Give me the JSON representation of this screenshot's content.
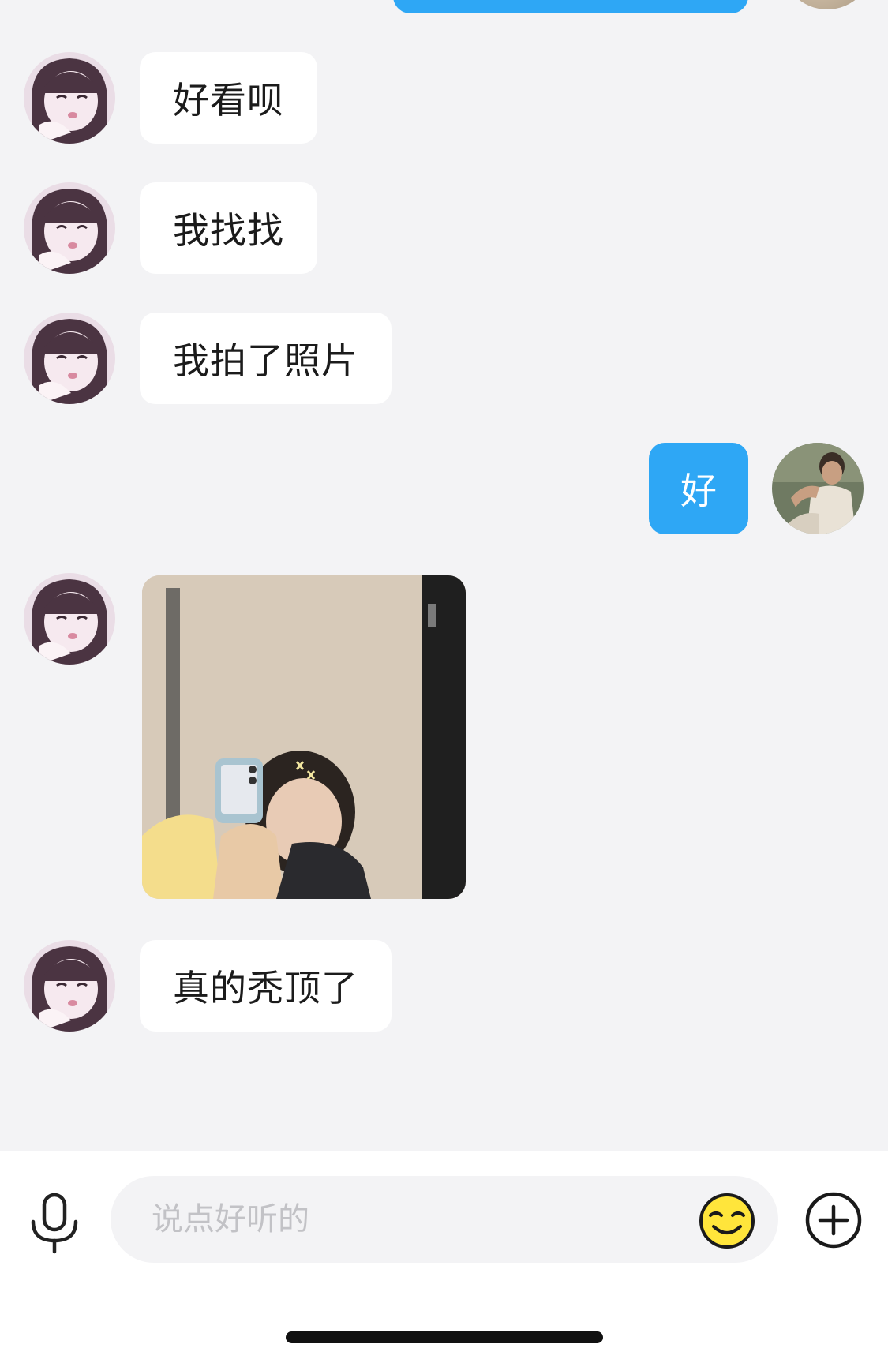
{
  "chat": {
    "messages": [
      {
        "from": "other",
        "type": "text",
        "text": "好看呗"
      },
      {
        "from": "other",
        "type": "text",
        "text": "我找找"
      },
      {
        "from": "other",
        "type": "text",
        "text": "我拍了照片"
      },
      {
        "from": "me",
        "type": "text",
        "text": "好"
      },
      {
        "from": "other",
        "type": "image",
        "description": "photo-selfie"
      },
      {
        "from": "other",
        "type": "text",
        "text": "真的秃顶了"
      }
    ]
  },
  "input": {
    "placeholder": "说点好听的",
    "value": ""
  },
  "icons": {
    "mic": "microphone-icon",
    "emoji": "emoji-icon",
    "plus": "plus-icon"
  },
  "colors": {
    "my_bubble": "#2ea7f5",
    "their_bubble": "#ffffff",
    "background": "#f3f3f5",
    "emoji_yellow": "#ffe53b"
  }
}
